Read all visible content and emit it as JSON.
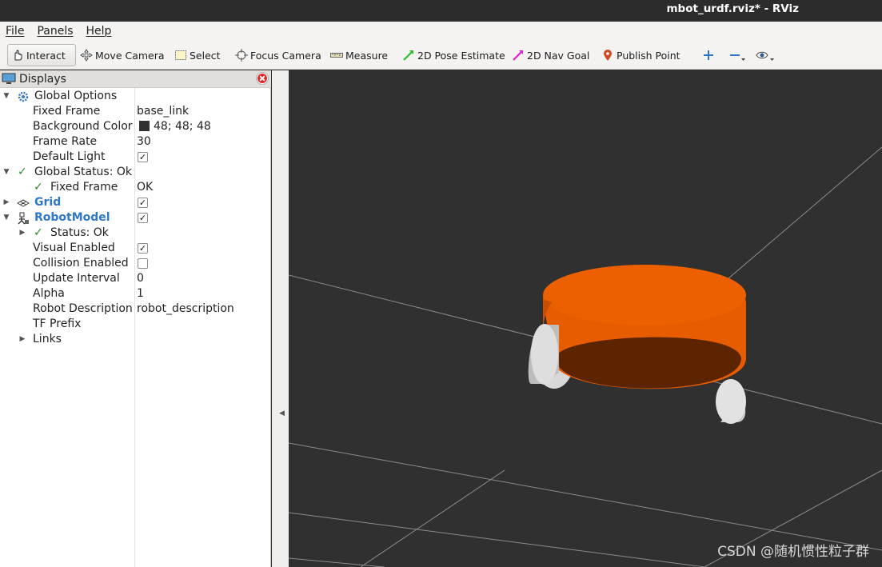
{
  "window": {
    "title": "mbot_urdf.rviz* - RViz"
  },
  "menu": [
    "File",
    "Panels",
    "Help"
  ],
  "toolbar": {
    "interact": "Interact",
    "move_camera": "Move Camera",
    "select": "Select",
    "focus_camera": "Focus Camera",
    "measure": "Measure",
    "pose_estimate": "2D Pose Estimate",
    "nav_goal": "2D Nav Goal",
    "publish_point": "Publish Point"
  },
  "displays": {
    "title": "Displays",
    "global_options": {
      "label": "Global Options",
      "fixed_frame": {
        "label": "Fixed Frame",
        "value": "base_link"
      },
      "background_color": {
        "label": "Background Color",
        "value": "48; 48; 48",
        "color": "#303030"
      },
      "frame_rate": {
        "label": "Frame Rate",
        "value": "30"
      },
      "default_light": {
        "label": "Default Light",
        "checked": true
      }
    },
    "global_status": {
      "label": "Global Status: Ok",
      "fixed_frame": {
        "label": "Fixed Frame",
        "value": "OK"
      }
    },
    "grid": {
      "label": "Grid",
      "checked": true
    },
    "robot_model": {
      "label": "RobotModel",
      "checked": true,
      "status": "Status: Ok",
      "visual_enabled": {
        "label": "Visual Enabled",
        "checked": true
      },
      "collision_enabled": {
        "label": "Collision Enabled",
        "checked": false
      },
      "update_interval": {
        "label": "Update Interval",
        "value": "0"
      },
      "alpha": {
        "label": "Alpha",
        "value": "1"
      },
      "robot_description": {
        "label": "Robot Description",
        "value": "robot_description"
      },
      "tf_prefix": {
        "label": "TF Prefix",
        "value": ""
      },
      "links": {
        "label": "Links"
      }
    }
  },
  "viewport": {
    "background": "#303030",
    "robot_color": "#e85c00",
    "watermark": "CSDN @随机惯性粒子群"
  }
}
